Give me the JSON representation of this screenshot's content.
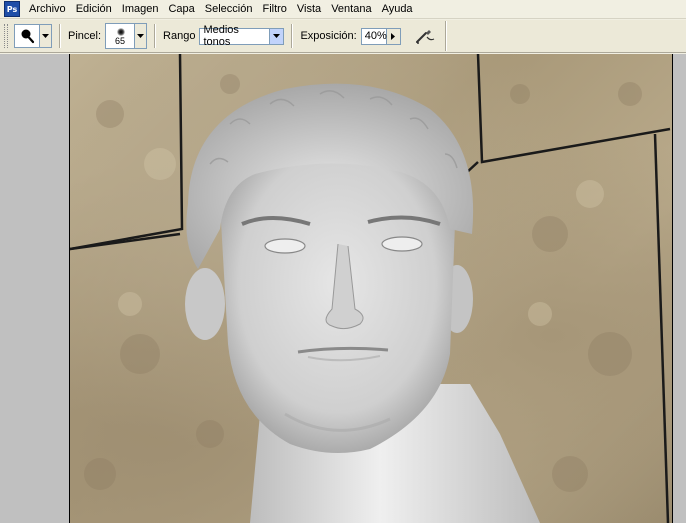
{
  "app": {
    "icon_label": "Ps"
  },
  "menubar": {
    "items": [
      "Archivo",
      "Edición",
      "Imagen",
      "Capa",
      "Selección",
      "Filtro",
      "Vista",
      "Ventana",
      "Ayuda"
    ]
  },
  "options": {
    "tool_icon": "burn-tool-icon",
    "brush_label": "Pincel:",
    "brush_size": "65",
    "range_label": "Rango",
    "range_value": "Medios tonos",
    "exposure_label": "Exposición:",
    "exposure_value": "40%",
    "airbrush_icon": "airbrush-icon"
  },
  "colors": {
    "menubar_bg": "#f1efe2",
    "toolbar_bg": "#ece9d8",
    "workspace_bg": "#c0c0c0",
    "stone": "#b2a385",
    "statue": "#d9d9d9"
  }
}
